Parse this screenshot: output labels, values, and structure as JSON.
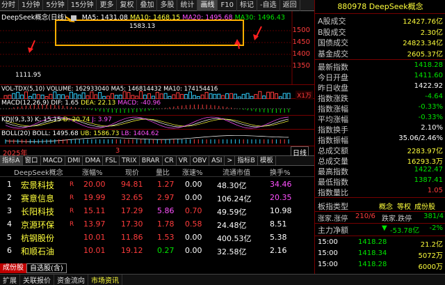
{
  "toolbar": {
    "items": [
      "分时",
      "1分钟",
      "5分钟",
      "15分钟",
      "更多",
      "复权",
      "叠加",
      "多股",
      "统计",
      "画线",
      "F10",
      "标记",
      "-自选",
      "返回"
    ],
    "active_index": 9
  },
  "main": {
    "title": "DeepSeek概念(日线)",
    "ma_labels": [
      {
        "text": "MA5: 1431.08",
        "color": "#ffffff"
      },
      {
        "text": "MA10: 1468.15",
        "color": "#ffff3c"
      },
      {
        "text": "MA20: 1495.68",
        "color": "#ff50ff"
      },
      {
        "text": "MA30: 1496.43",
        "color": "#00e600"
      }
    ],
    "yticks": [
      "1500",
      "1450",
      "1400",
      "1350"
    ],
    "annotation_high": "1583.13",
    "annotation_low": "1111.95"
  },
  "panels": {
    "vol": {
      "hdr": "VOL-TDX(5,10) VOLUME: 162933040 MA5: 146814432 MA10: 174154416",
      "unit": "X1万"
    },
    "macd": {
      "name": "MACD(12,26,9)",
      "dif": "DIF: 1.65",
      "dea": "DEA: 22.13",
      "macd": "MACD: -40.96"
    },
    "kdj": {
      "name": "KDJ(9,3,3)",
      "k": "K: 15.15",
      "d": "D: 20.74",
      "j": "J: 3.97"
    },
    "boll": {
      "name": "BOLL(20)",
      "boll": "BOLL: 1495.68",
      "ub": "UB: 1586.73",
      "lb": "LB: 1404.62"
    }
  },
  "date_row": {
    "year": "2025年",
    "month": "3",
    "period": "日线"
  },
  "indicator_tabs": [
    "指标A",
    "窗口",
    "MACD",
    "DMI",
    "DMA",
    "FSL",
    "TRIX",
    "BRAR",
    "CR",
    "VR",
    "OBV",
    "ASI",
    ">",
    "指标B",
    "模板"
  ],
  "table": {
    "headers": [
      "DeepSeek概念",
      "涨幅%",
      "现价",
      "量比",
      "涨速%",
      "流通市值",
      "换手%"
    ],
    "rows": [
      {
        "n": "1",
        "name": "宏景科技",
        "flag": "R",
        "chg": "20.00",
        "price": "94.81",
        "vr": "1.27",
        "spd": "0.00",
        "cap": "48.30亿",
        "turn": "34.46"
      },
      {
        "n": "2",
        "name": "赛意信息",
        "flag": "R",
        "chg": "19.99",
        "price": "32.65",
        "vr": "2.97",
        "spd": "0.00",
        "cap": "106.24亿",
        "turn": "20.35"
      },
      {
        "n": "3",
        "name": "长阳科技",
        "flag": "R",
        "chg": "15.11",
        "price": "17.29",
        "vr": "5.86",
        "spd": "0.70",
        "cap": "49.59亿",
        "turn": "10.98"
      },
      {
        "n": "4",
        "name": "京源环保",
        "flag": "R",
        "chg": "13.97",
        "price": "17.30",
        "vr": "1.78",
        "spd": "0.58",
        "cap": "24.48亿",
        "turn": "8.51"
      },
      {
        "n": "5",
        "name": "杭钢股份",
        "flag": "",
        "chg": "10.01",
        "price": "11.86",
        "vr": "1.53",
        "spd": "0.00",
        "cap": "400.53亿",
        "turn": "5.38"
      },
      {
        "n": "6",
        "name": "和顺石油",
        "flag": "",
        "chg": "10.01",
        "price": "19.12",
        "vr": "0.27",
        "spd": "0.00",
        "cap": "32.58亿",
        "turn": "2.16"
      }
    ]
  },
  "bottom_tabs": [
    "成份股",
    "自选股(含)"
  ],
  "status_bar": [
    "扩展",
    "关联报价",
    "资金流向",
    "市场资讯"
  ],
  "right": {
    "title": "880978 DeepSeek概念",
    "group1": [
      {
        "label": "A股成交",
        "value": "12427.76亿",
        "color": "#ffff3c"
      },
      {
        "label": "B股成交",
        "value": "2.30亿",
        "color": "#ffff3c"
      },
      {
        "label": "国债成交",
        "value": "24823.34亿",
        "color": "#ffff3c"
      },
      {
        "label": "基金成交",
        "value": "2605.37亿",
        "color": "#ffff3c"
      }
    ],
    "group2": [
      {
        "label": "最新指数",
        "value": "1418.28",
        "color": "#00e600"
      },
      {
        "label": "今日开盘",
        "value": "1411.60",
        "color": "#00e600"
      },
      {
        "label": "昨日收盘",
        "value": "1422.92",
        "color": "#ffffff"
      },
      {
        "label": "指数涨跌",
        "value": "-4.64",
        "color": "#00e600"
      },
      {
        "label": "指数涨幅",
        "value": "-0.33%",
        "color": "#00e600"
      },
      {
        "label": "平均涨幅",
        "value": "-0.33%",
        "color": "#00e600"
      },
      {
        "label": "指数换手",
        "value": "2.10%",
        "color": "#ffffff"
      },
      {
        "label": "指数振幅",
        "value": "35.06/2.46%",
        "color": "#ffffff"
      },
      {
        "label": "总成交额",
        "value": "2283.97亿",
        "color": "#ffff3c"
      },
      {
        "label": "总成交量",
        "value": "16293.3万",
        "color": "#ffff3c"
      },
      {
        "label": "最高指数",
        "value": "1422.47",
        "color": "#00e600"
      },
      {
        "label": "最低指数",
        "value": "1387.41",
        "color": "#00e600"
      },
      {
        "label": "指数量比",
        "value": "1.05",
        "color": "#ff3c3c"
      }
    ],
    "board_label": "板指类型",
    "board_values": [
      "概念",
      "等权",
      "成份股"
    ],
    "updown": {
      "label1": "涨家.涨停",
      "v1": "210/6",
      "label2": "跌家.跌停",
      "v2": "381/4"
    },
    "flow": {
      "label": "主力净额",
      "arrow": "▼",
      "value": "-53.78亿",
      "pct": "-2%"
    },
    "ticks": [
      {
        "time": "15:00",
        "price": "1418.28",
        "vol": "21.2亿"
      },
      {
        "time": "15:00",
        "price": "1418.34",
        "vol": "5072万"
      },
      {
        "time": "15:00",
        "price": "1418.28",
        "vol": "6000万"
      }
    ]
  }
}
